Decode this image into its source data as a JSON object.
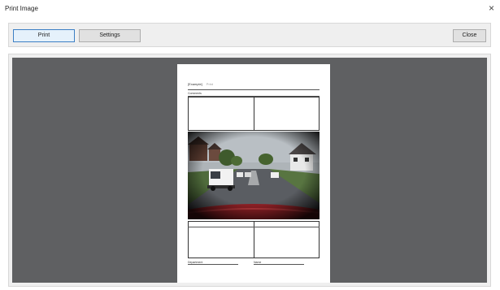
{
  "window": {
    "title": "Print Image",
    "close_glyph": "×",
    "close_icon": "close-icon"
  },
  "toolbar": {
    "print_label": "Print",
    "settings_label": "Settings",
    "close_label": "Close"
  },
  "page": {
    "header_text": "[Example]",
    "header_placeholder": "Print",
    "comments_label": "Comments",
    "department_label": "Department",
    "name_label": "Name"
  },
  "colors": {
    "preview_bg": "#5f6062",
    "print_button_border": "#3c7fc4"
  }
}
